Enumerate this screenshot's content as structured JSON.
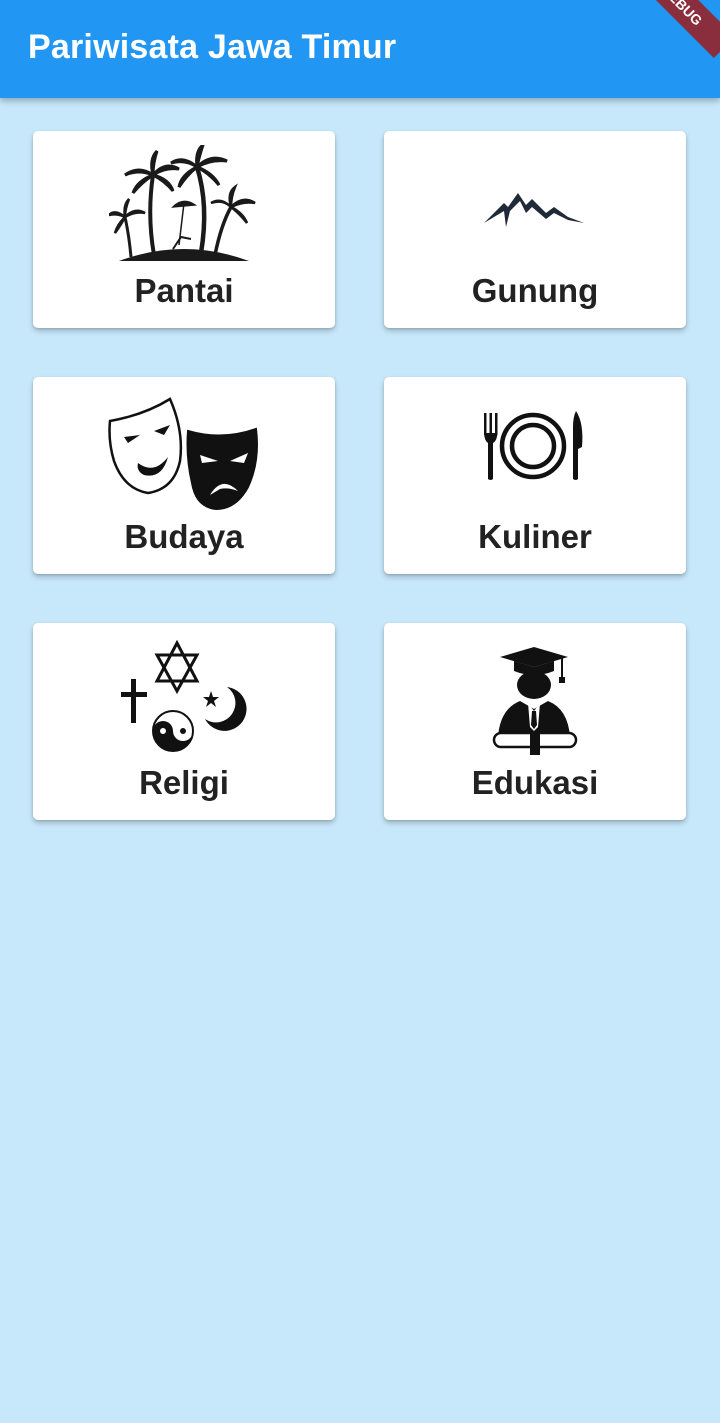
{
  "app": {
    "title": "Pariwisata Jawa Timur",
    "debug_banner": "DEBUG",
    "appbar_color": "#2196f3",
    "background_color": "#c7e8fb"
  },
  "categories": [
    {
      "label": "Pantai",
      "icon": "palm-island-icon"
    },
    {
      "label": "Gunung",
      "icon": "mountain-icon"
    },
    {
      "label": "Budaya",
      "icon": "theater-masks-icon"
    },
    {
      "label": "Kuliner",
      "icon": "fork-plate-knife-icon"
    },
    {
      "label": "Religi",
      "icon": "religious-symbols-icon"
    },
    {
      "label": "Edukasi",
      "icon": "graduate-icon"
    }
  ]
}
